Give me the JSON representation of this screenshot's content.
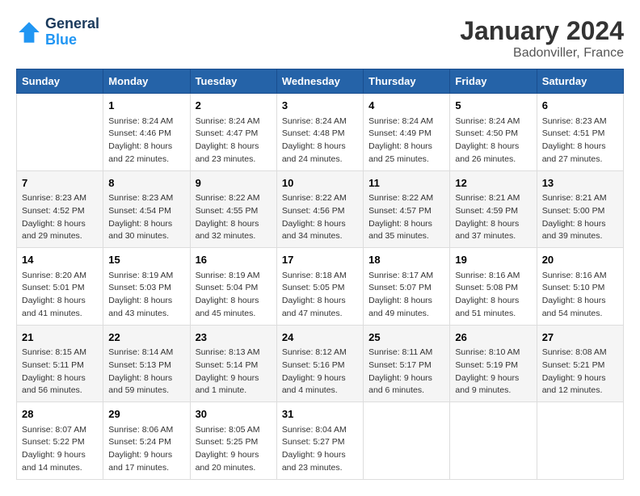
{
  "header": {
    "logo_line1": "General",
    "logo_line2": "Blue",
    "title": "January 2024",
    "subtitle": "Badonviller, France"
  },
  "weekdays": [
    "Sunday",
    "Monday",
    "Tuesday",
    "Wednesday",
    "Thursday",
    "Friday",
    "Saturday"
  ],
  "weeks": [
    [
      {
        "day": "",
        "sunrise": "",
        "sunset": "",
        "daylight": ""
      },
      {
        "day": "1",
        "sunrise": "Sunrise: 8:24 AM",
        "sunset": "Sunset: 4:46 PM",
        "daylight": "Daylight: 8 hours and 22 minutes."
      },
      {
        "day": "2",
        "sunrise": "Sunrise: 8:24 AM",
        "sunset": "Sunset: 4:47 PM",
        "daylight": "Daylight: 8 hours and 23 minutes."
      },
      {
        "day": "3",
        "sunrise": "Sunrise: 8:24 AM",
        "sunset": "Sunset: 4:48 PM",
        "daylight": "Daylight: 8 hours and 24 minutes."
      },
      {
        "day": "4",
        "sunrise": "Sunrise: 8:24 AM",
        "sunset": "Sunset: 4:49 PM",
        "daylight": "Daylight: 8 hours and 25 minutes."
      },
      {
        "day": "5",
        "sunrise": "Sunrise: 8:24 AM",
        "sunset": "Sunset: 4:50 PM",
        "daylight": "Daylight: 8 hours and 26 minutes."
      },
      {
        "day": "6",
        "sunrise": "Sunrise: 8:23 AM",
        "sunset": "Sunset: 4:51 PM",
        "daylight": "Daylight: 8 hours and 27 minutes."
      }
    ],
    [
      {
        "day": "7",
        "sunrise": "Sunrise: 8:23 AM",
        "sunset": "Sunset: 4:52 PM",
        "daylight": "Daylight: 8 hours and 29 minutes."
      },
      {
        "day": "8",
        "sunrise": "Sunrise: 8:23 AM",
        "sunset": "Sunset: 4:54 PM",
        "daylight": "Daylight: 8 hours and 30 minutes."
      },
      {
        "day": "9",
        "sunrise": "Sunrise: 8:22 AM",
        "sunset": "Sunset: 4:55 PM",
        "daylight": "Daylight: 8 hours and 32 minutes."
      },
      {
        "day": "10",
        "sunrise": "Sunrise: 8:22 AM",
        "sunset": "Sunset: 4:56 PM",
        "daylight": "Daylight: 8 hours and 34 minutes."
      },
      {
        "day": "11",
        "sunrise": "Sunrise: 8:22 AM",
        "sunset": "Sunset: 4:57 PM",
        "daylight": "Daylight: 8 hours and 35 minutes."
      },
      {
        "day": "12",
        "sunrise": "Sunrise: 8:21 AM",
        "sunset": "Sunset: 4:59 PM",
        "daylight": "Daylight: 8 hours and 37 minutes."
      },
      {
        "day": "13",
        "sunrise": "Sunrise: 8:21 AM",
        "sunset": "Sunset: 5:00 PM",
        "daylight": "Daylight: 8 hours and 39 minutes."
      }
    ],
    [
      {
        "day": "14",
        "sunrise": "Sunrise: 8:20 AM",
        "sunset": "Sunset: 5:01 PM",
        "daylight": "Daylight: 8 hours and 41 minutes."
      },
      {
        "day": "15",
        "sunrise": "Sunrise: 8:19 AM",
        "sunset": "Sunset: 5:03 PM",
        "daylight": "Daylight: 8 hours and 43 minutes."
      },
      {
        "day": "16",
        "sunrise": "Sunrise: 8:19 AM",
        "sunset": "Sunset: 5:04 PM",
        "daylight": "Daylight: 8 hours and 45 minutes."
      },
      {
        "day": "17",
        "sunrise": "Sunrise: 8:18 AM",
        "sunset": "Sunset: 5:05 PM",
        "daylight": "Daylight: 8 hours and 47 minutes."
      },
      {
        "day": "18",
        "sunrise": "Sunrise: 8:17 AM",
        "sunset": "Sunset: 5:07 PM",
        "daylight": "Daylight: 8 hours and 49 minutes."
      },
      {
        "day": "19",
        "sunrise": "Sunrise: 8:16 AM",
        "sunset": "Sunset: 5:08 PM",
        "daylight": "Daylight: 8 hours and 51 minutes."
      },
      {
        "day": "20",
        "sunrise": "Sunrise: 8:16 AM",
        "sunset": "Sunset: 5:10 PM",
        "daylight": "Daylight: 8 hours and 54 minutes."
      }
    ],
    [
      {
        "day": "21",
        "sunrise": "Sunrise: 8:15 AM",
        "sunset": "Sunset: 5:11 PM",
        "daylight": "Daylight: 8 hours and 56 minutes."
      },
      {
        "day": "22",
        "sunrise": "Sunrise: 8:14 AM",
        "sunset": "Sunset: 5:13 PM",
        "daylight": "Daylight: 8 hours and 59 minutes."
      },
      {
        "day": "23",
        "sunrise": "Sunrise: 8:13 AM",
        "sunset": "Sunset: 5:14 PM",
        "daylight": "Daylight: 9 hours and 1 minute."
      },
      {
        "day": "24",
        "sunrise": "Sunrise: 8:12 AM",
        "sunset": "Sunset: 5:16 PM",
        "daylight": "Daylight: 9 hours and 4 minutes."
      },
      {
        "day": "25",
        "sunrise": "Sunrise: 8:11 AM",
        "sunset": "Sunset: 5:17 PM",
        "daylight": "Daylight: 9 hours and 6 minutes."
      },
      {
        "day": "26",
        "sunrise": "Sunrise: 8:10 AM",
        "sunset": "Sunset: 5:19 PM",
        "daylight": "Daylight: 9 hours and 9 minutes."
      },
      {
        "day": "27",
        "sunrise": "Sunrise: 8:08 AM",
        "sunset": "Sunset: 5:21 PM",
        "daylight": "Daylight: 9 hours and 12 minutes."
      }
    ],
    [
      {
        "day": "28",
        "sunrise": "Sunrise: 8:07 AM",
        "sunset": "Sunset: 5:22 PM",
        "daylight": "Daylight: 9 hours and 14 minutes."
      },
      {
        "day": "29",
        "sunrise": "Sunrise: 8:06 AM",
        "sunset": "Sunset: 5:24 PM",
        "daylight": "Daylight: 9 hours and 17 minutes."
      },
      {
        "day": "30",
        "sunrise": "Sunrise: 8:05 AM",
        "sunset": "Sunset: 5:25 PM",
        "daylight": "Daylight: 9 hours and 20 minutes."
      },
      {
        "day": "31",
        "sunrise": "Sunrise: 8:04 AM",
        "sunset": "Sunset: 5:27 PM",
        "daylight": "Daylight: 9 hours and 23 minutes."
      },
      {
        "day": "",
        "sunrise": "",
        "sunset": "",
        "daylight": ""
      },
      {
        "day": "",
        "sunrise": "",
        "sunset": "",
        "daylight": ""
      },
      {
        "day": "",
        "sunrise": "",
        "sunset": "",
        "daylight": ""
      }
    ]
  ]
}
